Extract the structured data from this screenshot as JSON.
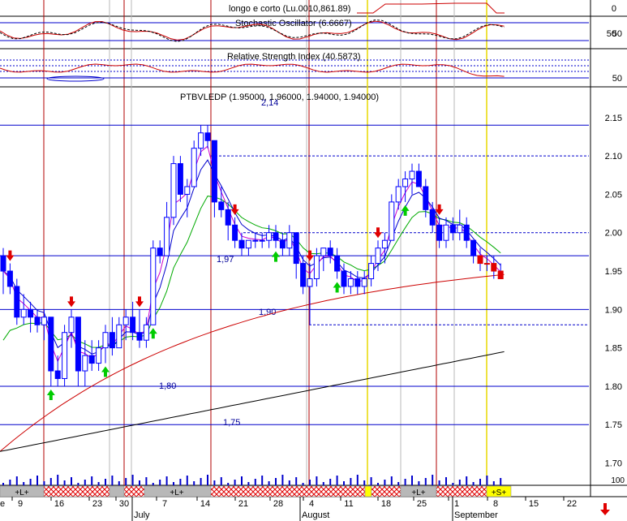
{
  "chart_data": {
    "type": "candlestick",
    "panels": {
      "top": {
        "header_label": "longo e corto (Lu.0010,861.89)",
        "y_ticks": [
          "0",
          "50"
        ]
      },
      "stochastic": {
        "title": "Stochastic Oscillator (6.6667)",
        "y_ticks": [
          "50"
        ]
      },
      "rsi": {
        "title": "Relative Strength Index (40.5873)",
        "y_ticks": [
          "50"
        ]
      },
      "main": {
        "title": "PTBVLEDP (1.95000, 1.96000, 1.94000, 1.94000)",
        "y_range": [
          1.69,
          2.19
        ],
        "y_ticks": [
          "2.15",
          "2.10",
          "2.05",
          "2.00",
          "1.95",
          "1.90",
          "1.85",
          "1.80",
          "1.75",
          "1.70"
        ],
        "level_labels": [
          {
            "value": 2.14,
            "text": "2,14"
          },
          {
            "value": 1.97,
            "text": "1,97"
          },
          {
            "value": 1.9,
            "text": "1,90"
          },
          {
            "value": 1.8,
            "text": "1,80"
          },
          {
            "value": 1.75,
            "text": "1,75"
          }
        ],
        "solid_levels": [
          2.14,
          1.97,
          1.9,
          1.8,
          1.75
        ],
        "dashed_levels": [
          2.1,
          2.0,
          1.88
        ]
      },
      "volume": {
        "y_tick": "100"
      }
    },
    "x_axis": {
      "tick_labels": [
        "9",
        "16",
        "23",
        "30",
        "7",
        "14",
        "21",
        "28",
        "4",
        "11",
        "18",
        "25",
        "1",
        "8",
        "15",
        "22"
      ],
      "month_labels": [
        "July",
        "August",
        "September"
      ]
    },
    "signal_bar": {
      "long_label": "+L+",
      "short_label": "+S+"
    },
    "candles": [
      {
        "o": 1.97,
        "h": 1.98,
        "l": 1.92,
        "c": 1.95
      },
      {
        "o": 1.95,
        "h": 1.96,
        "l": 1.92,
        "c": 1.93
      },
      {
        "o": 1.93,
        "h": 1.94,
        "l": 1.88,
        "c": 1.89
      },
      {
        "o": 1.89,
        "h": 1.92,
        "l": 1.88,
        "c": 1.9
      },
      {
        "o": 1.9,
        "h": 1.91,
        "l": 1.87,
        "c": 1.89
      },
      {
        "o": 1.89,
        "h": 1.9,
        "l": 1.87,
        "c": 1.88
      },
      {
        "o": 1.88,
        "h": 1.9,
        "l": 1.86,
        "c": 1.89
      },
      {
        "o": 1.89,
        "h": 1.89,
        "l": 1.8,
        "c": 1.82
      },
      {
        "o": 1.82,
        "h": 1.84,
        "l": 1.8,
        "c": 1.81
      },
      {
        "o": 1.81,
        "h": 1.88,
        "l": 1.8,
        "c": 1.87
      },
      {
        "o": 1.87,
        "h": 1.9,
        "l": 1.85,
        "c": 1.89
      },
      {
        "o": 1.89,
        "h": 1.89,
        "l": 1.8,
        "c": 1.82
      },
      {
        "o": 1.82,
        "h": 1.86,
        "l": 1.8,
        "c": 1.84
      },
      {
        "o": 1.84,
        "h": 1.86,
        "l": 1.82,
        "c": 1.83
      },
      {
        "o": 1.83,
        "h": 1.86,
        "l": 1.82,
        "c": 1.85
      },
      {
        "o": 1.85,
        "h": 1.88,
        "l": 1.83,
        "c": 1.87
      },
      {
        "o": 1.87,
        "h": 1.89,
        "l": 1.84,
        "c": 1.85
      },
      {
        "o": 1.85,
        "h": 1.89,
        "l": 1.85,
        "c": 1.88
      },
      {
        "o": 1.88,
        "h": 1.9,
        "l": 1.86,
        "c": 1.89
      },
      {
        "o": 1.89,
        "h": 1.91,
        "l": 1.86,
        "c": 1.87
      },
      {
        "o": 1.87,
        "h": 1.9,
        "l": 1.85,
        "c": 1.86
      },
      {
        "o": 1.86,
        "h": 1.89,
        "l": 1.85,
        "c": 1.88
      },
      {
        "o": 1.88,
        "h": 1.99,
        "l": 1.88,
        "c": 1.98
      },
      {
        "o": 1.98,
        "h": 1.99,
        "l": 1.96,
        "c": 1.97
      },
      {
        "o": 1.97,
        "h": 2.04,
        "l": 1.97,
        "c": 2.02
      },
      {
        "o": 2.02,
        "h": 2.1,
        "l": 2.01,
        "c": 2.09
      },
      {
        "o": 2.09,
        "h": 2.1,
        "l": 2.04,
        "c": 2.05
      },
      {
        "o": 2.05,
        "h": 2.07,
        "l": 2.02,
        "c": 2.06
      },
      {
        "o": 2.06,
        "h": 2.12,
        "l": 2.06,
        "c": 2.11
      },
      {
        "o": 2.11,
        "h": 2.14,
        "l": 2.1,
        "c": 2.13
      },
      {
        "o": 2.13,
        "h": 2.14,
        "l": 2.11,
        "c": 2.12
      },
      {
        "o": 2.12,
        "h": 2.12,
        "l": 2.02,
        "c": 2.04
      },
      {
        "o": 2.04,
        "h": 2.06,
        "l": 2.02,
        "c": 2.03
      },
      {
        "o": 2.03,
        "h": 2.04,
        "l": 1.99,
        "c": 2.01
      },
      {
        "o": 2.01,
        "h": 2.02,
        "l": 1.98,
        "c": 1.99
      },
      {
        "o": 1.99,
        "h": 2.0,
        "l": 1.97,
        "c": 1.98
      },
      {
        "o": 1.98,
        "h": 1.99,
        "l": 1.97,
        "c": 1.99
      },
      {
        "o": 1.99,
        "h": 2.0,
        "l": 1.98,
        "c": 1.99
      },
      {
        "o": 1.99,
        "h": 2.0,
        "l": 1.98,
        "c": 1.99
      },
      {
        "o": 1.99,
        "h": 2.01,
        "l": 1.98,
        "c": 2.0
      },
      {
        "o": 2.0,
        "h": 2.01,
        "l": 1.98,
        "c": 1.99
      },
      {
        "o": 1.99,
        "h": 2.0,
        "l": 1.97,
        "c": 1.98
      },
      {
        "o": 1.98,
        "h": 2.01,
        "l": 1.97,
        "c": 2.0
      },
      {
        "o": 2.0,
        "h": 2.0,
        "l": 1.94,
        "c": 1.96
      },
      {
        "o": 1.96,
        "h": 1.97,
        "l": 1.92,
        "c": 1.93
      },
      {
        "o": 1.93,
        "h": 1.96,
        "l": 1.88,
        "c": 1.94
      },
      {
        "o": 1.94,
        "h": 1.98,
        "l": 1.93,
        "c": 1.97
      },
      {
        "o": 1.97,
        "h": 1.98,
        "l": 1.95,
        "c": 1.98
      },
      {
        "o": 1.98,
        "h": 1.99,
        "l": 1.96,
        "c": 1.97
      },
      {
        "o": 1.97,
        "h": 1.98,
        "l": 1.94,
        "c": 1.95
      },
      {
        "o": 1.95,
        "h": 1.96,
        "l": 1.92,
        "c": 1.93
      },
      {
        "o": 1.93,
        "h": 1.95,
        "l": 1.92,
        "c": 1.94
      },
      {
        "o": 1.94,
        "h": 1.95,
        "l": 1.92,
        "c": 1.93
      },
      {
        "o": 1.93,
        "h": 1.95,
        "l": 1.92,
        "c": 1.94
      },
      {
        "o": 1.94,
        "h": 1.97,
        "l": 1.93,
        "c": 1.96
      },
      {
        "o": 1.96,
        "h": 1.99,
        "l": 1.95,
        "c": 1.98
      },
      {
        "o": 1.98,
        "h": 2.0,
        "l": 1.96,
        "c": 1.99
      },
      {
        "o": 1.99,
        "h": 2.05,
        "l": 1.99,
        "c": 2.04
      },
      {
        "o": 2.04,
        "h": 2.07,
        "l": 2.03,
        "c": 2.06
      },
      {
        "o": 2.06,
        "h": 2.08,
        "l": 2.04,
        "c": 2.07
      },
      {
        "o": 2.07,
        "h": 2.09,
        "l": 2.05,
        "c": 2.08
      },
      {
        "o": 2.08,
        "h": 2.09,
        "l": 2.06,
        "c": 2.06
      },
      {
        "o": 2.06,
        "h": 2.07,
        "l": 2.02,
        "c": 2.03
      },
      {
        "o": 2.03,
        "h": 2.04,
        "l": 2.0,
        "c": 2.01
      },
      {
        "o": 2.01,
        "h": 2.02,
        "l": 1.98,
        "c": 1.99
      },
      {
        "o": 1.99,
        "h": 2.02,
        "l": 1.98,
        "c": 2.01
      },
      {
        "o": 2.01,
        "h": 2.02,
        "l": 1.99,
        "c": 2.0
      },
      {
        "o": 2.0,
        "h": 2.03,
        "l": 1.99,
        "c": 2.01
      },
      {
        "o": 2.01,
        "h": 2.02,
        "l": 1.98,
        "c": 1.99
      },
      {
        "o": 1.99,
        "h": 1.99,
        "l": 1.96,
        "c": 1.97
      },
      {
        "o": 1.97,
        "h": 1.98,
        "l": 1.95,
        "c": 1.96
      },
      {
        "o": 1.96,
        "h": 1.97,
        "l": 1.95,
        "c": 1.96
      },
      {
        "o": 1.96,
        "h": 1.97,
        "l": 1.94,
        "c": 1.95
      },
      {
        "o": 1.95,
        "h": 1.96,
        "l": 1.94,
        "c": 1.94
      }
    ],
    "candle_colors": {
      "up": "#ffffff",
      "down": "#0000ff",
      "outline": "#0000ff"
    },
    "buy_signal_indices": [
      7,
      15,
      22,
      40,
      49,
      59
    ],
    "sell_signal_indices": [
      1,
      10,
      20,
      34,
      45,
      55,
      64
    ],
    "series_colors": {
      "ema_fast": "#0000cc",
      "ema_mid": "#cc00cc",
      "ema_green": "#00aa00",
      "ema_red": "#cc0000",
      "ema_black": "#000000"
    },
    "sell_color": "#e00000",
    "buy_color": "#00cc00",
    "grid": false
  }
}
